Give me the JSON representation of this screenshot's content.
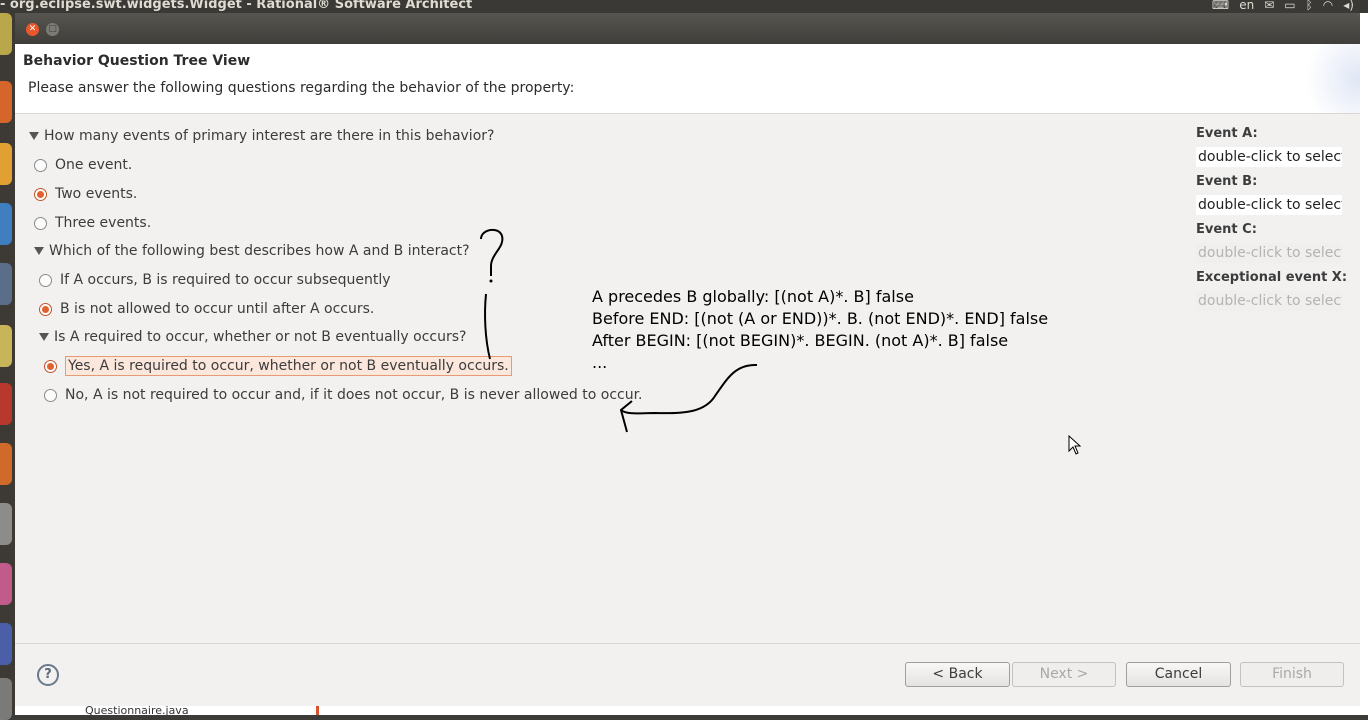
{
  "top_panel": {
    "window_title": "- org.eclipse.swt.widgets.Widget - Rational® Software Architect",
    "keyboard_layout": "en"
  },
  "dialog": {
    "title": "Behavior Question Tree View",
    "message": "Please answer the following questions regarding the behavior of the property:",
    "questions": [
      {
        "text": "How many events of primary interest are there in this behavior?",
        "options": [
          {
            "label": "One event.",
            "selected": false
          },
          {
            "label": "Two events.",
            "selected": true
          },
          {
            "label": "Three events.",
            "selected": false
          }
        ]
      },
      {
        "text": "Which of the following best describes how A and B interact?",
        "options": [
          {
            "label": "If A occurs, B is required to occur subsequently",
            "selected": false
          },
          {
            "label": "B is not allowed to occur until after A occurs.",
            "selected": true
          }
        ]
      },
      {
        "text": "Is A required to occur, whether or not B eventually occurs?",
        "options": [
          {
            "label": "Yes, A is required to occur, whether or not B eventually occurs.",
            "selected": true
          },
          {
            "label": "No, A is not required to occur and, if it does not occur, B is never allowed to occur.",
            "selected": false
          }
        ]
      }
    ],
    "annotation_lines": [
      "A precedes B globally: [(not A)*. B] false",
      "Before END: [(not (A or END))*. B. (not END)*. END] false",
      "After BEGIN:  [(not BEGIN)*. BEGIN. (not A)*. B] false",
      "..."
    ],
    "handwritten_mark": "?",
    "events": [
      {
        "label": "Event A:",
        "value": "double-click to select",
        "enabled": true
      },
      {
        "label": "Event B:",
        "value": "double-click to select",
        "enabled": true
      },
      {
        "label": "Event C:",
        "value": "double-click to select",
        "enabled": false
      },
      {
        "label": "Exceptional event X:",
        "value": "double-click to select",
        "enabled": false
      }
    ],
    "buttons": {
      "help": "?",
      "back": "< Back",
      "next": "Next >",
      "cancel": "Cancel",
      "finish": "Finish"
    }
  },
  "background": {
    "bottom_text": "Questionnaire.java"
  },
  "colors": {
    "accent": "#e1602f",
    "highlight_bg": "#fbe7dc",
    "panel": "#3c3b37"
  }
}
